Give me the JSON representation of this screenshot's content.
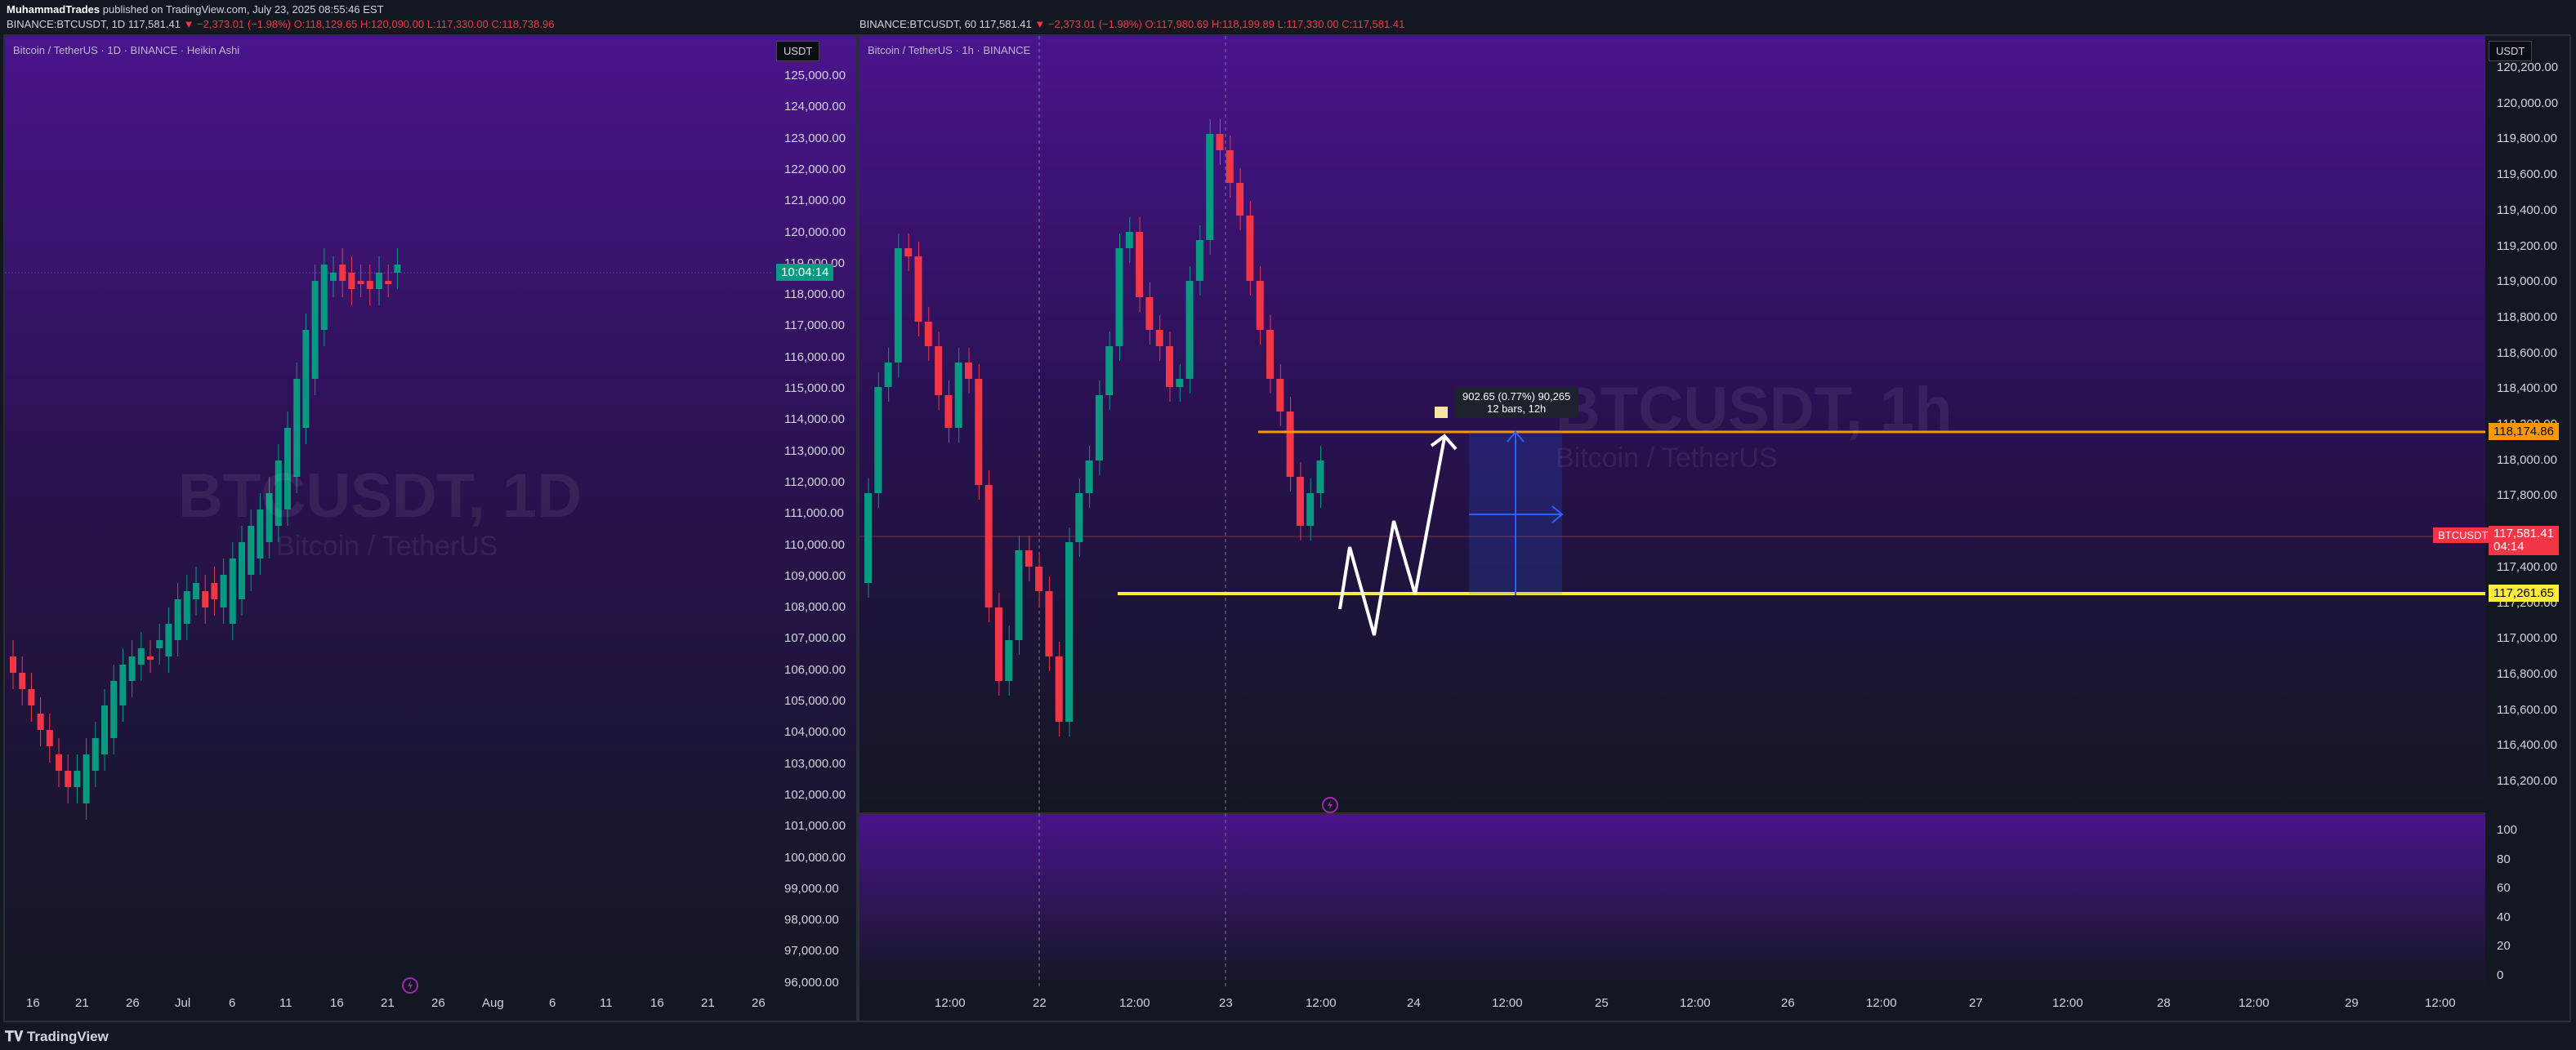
{
  "header": {
    "author": "MuhammadTrades",
    "published": " published on TradingView.com, July 23, 2025 08:55:46 EST",
    "left_symbol": "BINANCE:BTCUSDT, 1D",
    "left_price": "117,581.41",
    "left_change": "▼ −2,373.01 (−1.98%)",
    "left_o": "O:118,129.65",
    "left_h": "H:120,090.00",
    "left_l": "L:117,330.00",
    "left_c": "C:118,738.96",
    "right_symbol": "BINANCE:BTCUSDT, 60",
    "right_price": "117,581.41",
    "right_change": "▼ −2,373.01 (−1.98%)",
    "right_o": "O:117,980.69",
    "right_h": "H:118,199.89",
    "right_l": "L:117,330.00",
    "right_c": "C:117,581.41"
  },
  "left_chart": {
    "label": "Bitcoin / TetherUS · 1D · BINANCE · Heikin Ashi",
    "currency": "USDT",
    "watermark_symbol": "BTCUSDT, 1D",
    "watermark_name": "Bitcoin / TetherUS",
    "countdown": "10:04:14",
    "y_ticks": [
      "125,000.00",
      "124,000.00",
      "123,000.00",
      "122,000.00",
      "121,000.00",
      "120,000.00",
      "119,000.00",
      "118,000.00",
      "117,000.00",
      "116,000.00",
      "115,000.00",
      "114,000.00",
      "113,000.00",
      "112,000.00",
      "111,000.00",
      "110,000.00",
      "109,000.00",
      "108,000.00",
      "107,000.00",
      "106,000.00",
      "105,000.00",
      "104,000.00",
      "103,000.00",
      "102,000.00",
      "101,000.00",
      "100,000.00",
      "99,000.00",
      "98,000.00",
      "97,000.00",
      "96,000.00"
    ],
    "x_ticks": [
      "16",
      "21",
      "26",
      "Jul",
      "6",
      "11",
      "16",
      "21",
      "26",
      "Aug",
      "6",
      "11",
      "16",
      "21",
      "26"
    ]
  },
  "right_chart": {
    "label": "Bitcoin / TetherUS · 1h · BINANCE",
    "currency": "USDT",
    "watermark_symbol": "BTCUSDT, 1h",
    "watermark_name": "Bitcoin / TetherUS",
    "y_ticks": [
      "120,200.00",
      "120,000.00",
      "119,800.00",
      "119,600.00",
      "119,400.00",
      "119,200.00",
      "119,000.00",
      "118,800.00",
      "118,600.00",
      "118,400.00",
      "118,200.00",
      "118,000.00",
      "117,800.00",
      "117,600.00",
      "117,400.00",
      "117,200.00",
      "117,000.00",
      "116,800.00",
      "116,600.00",
      "116,400.00",
      "116,200.00"
    ],
    "osc_ticks": [
      "100",
      "80",
      "60",
      "40",
      "20",
      "0"
    ],
    "x_ticks": [
      "12:00",
      "22",
      "12:00",
      "23",
      "12:00",
      "24",
      "12:00",
      "25",
      "12:00",
      "26",
      "12:00",
      "27",
      "12:00",
      "28",
      "12:00",
      "29",
      "12:00"
    ],
    "resistance_price": "118,174.86",
    "support_price": "117,261.65",
    "symbol_tag": "BTCUSDT",
    "last_price": "117,581.41",
    "last_countdown": "04:14",
    "measure_line1": "902.65 (0.77%) 90,265",
    "measure_line2": "12 bars, 12h"
  },
  "footer": {
    "brand": "TradingView"
  },
  "colors": {
    "bull": "#089981",
    "bear": "#f23645",
    "resistance": "#ff9800",
    "support": "#ffeb3b",
    "accent": "#4a148c"
  }
}
